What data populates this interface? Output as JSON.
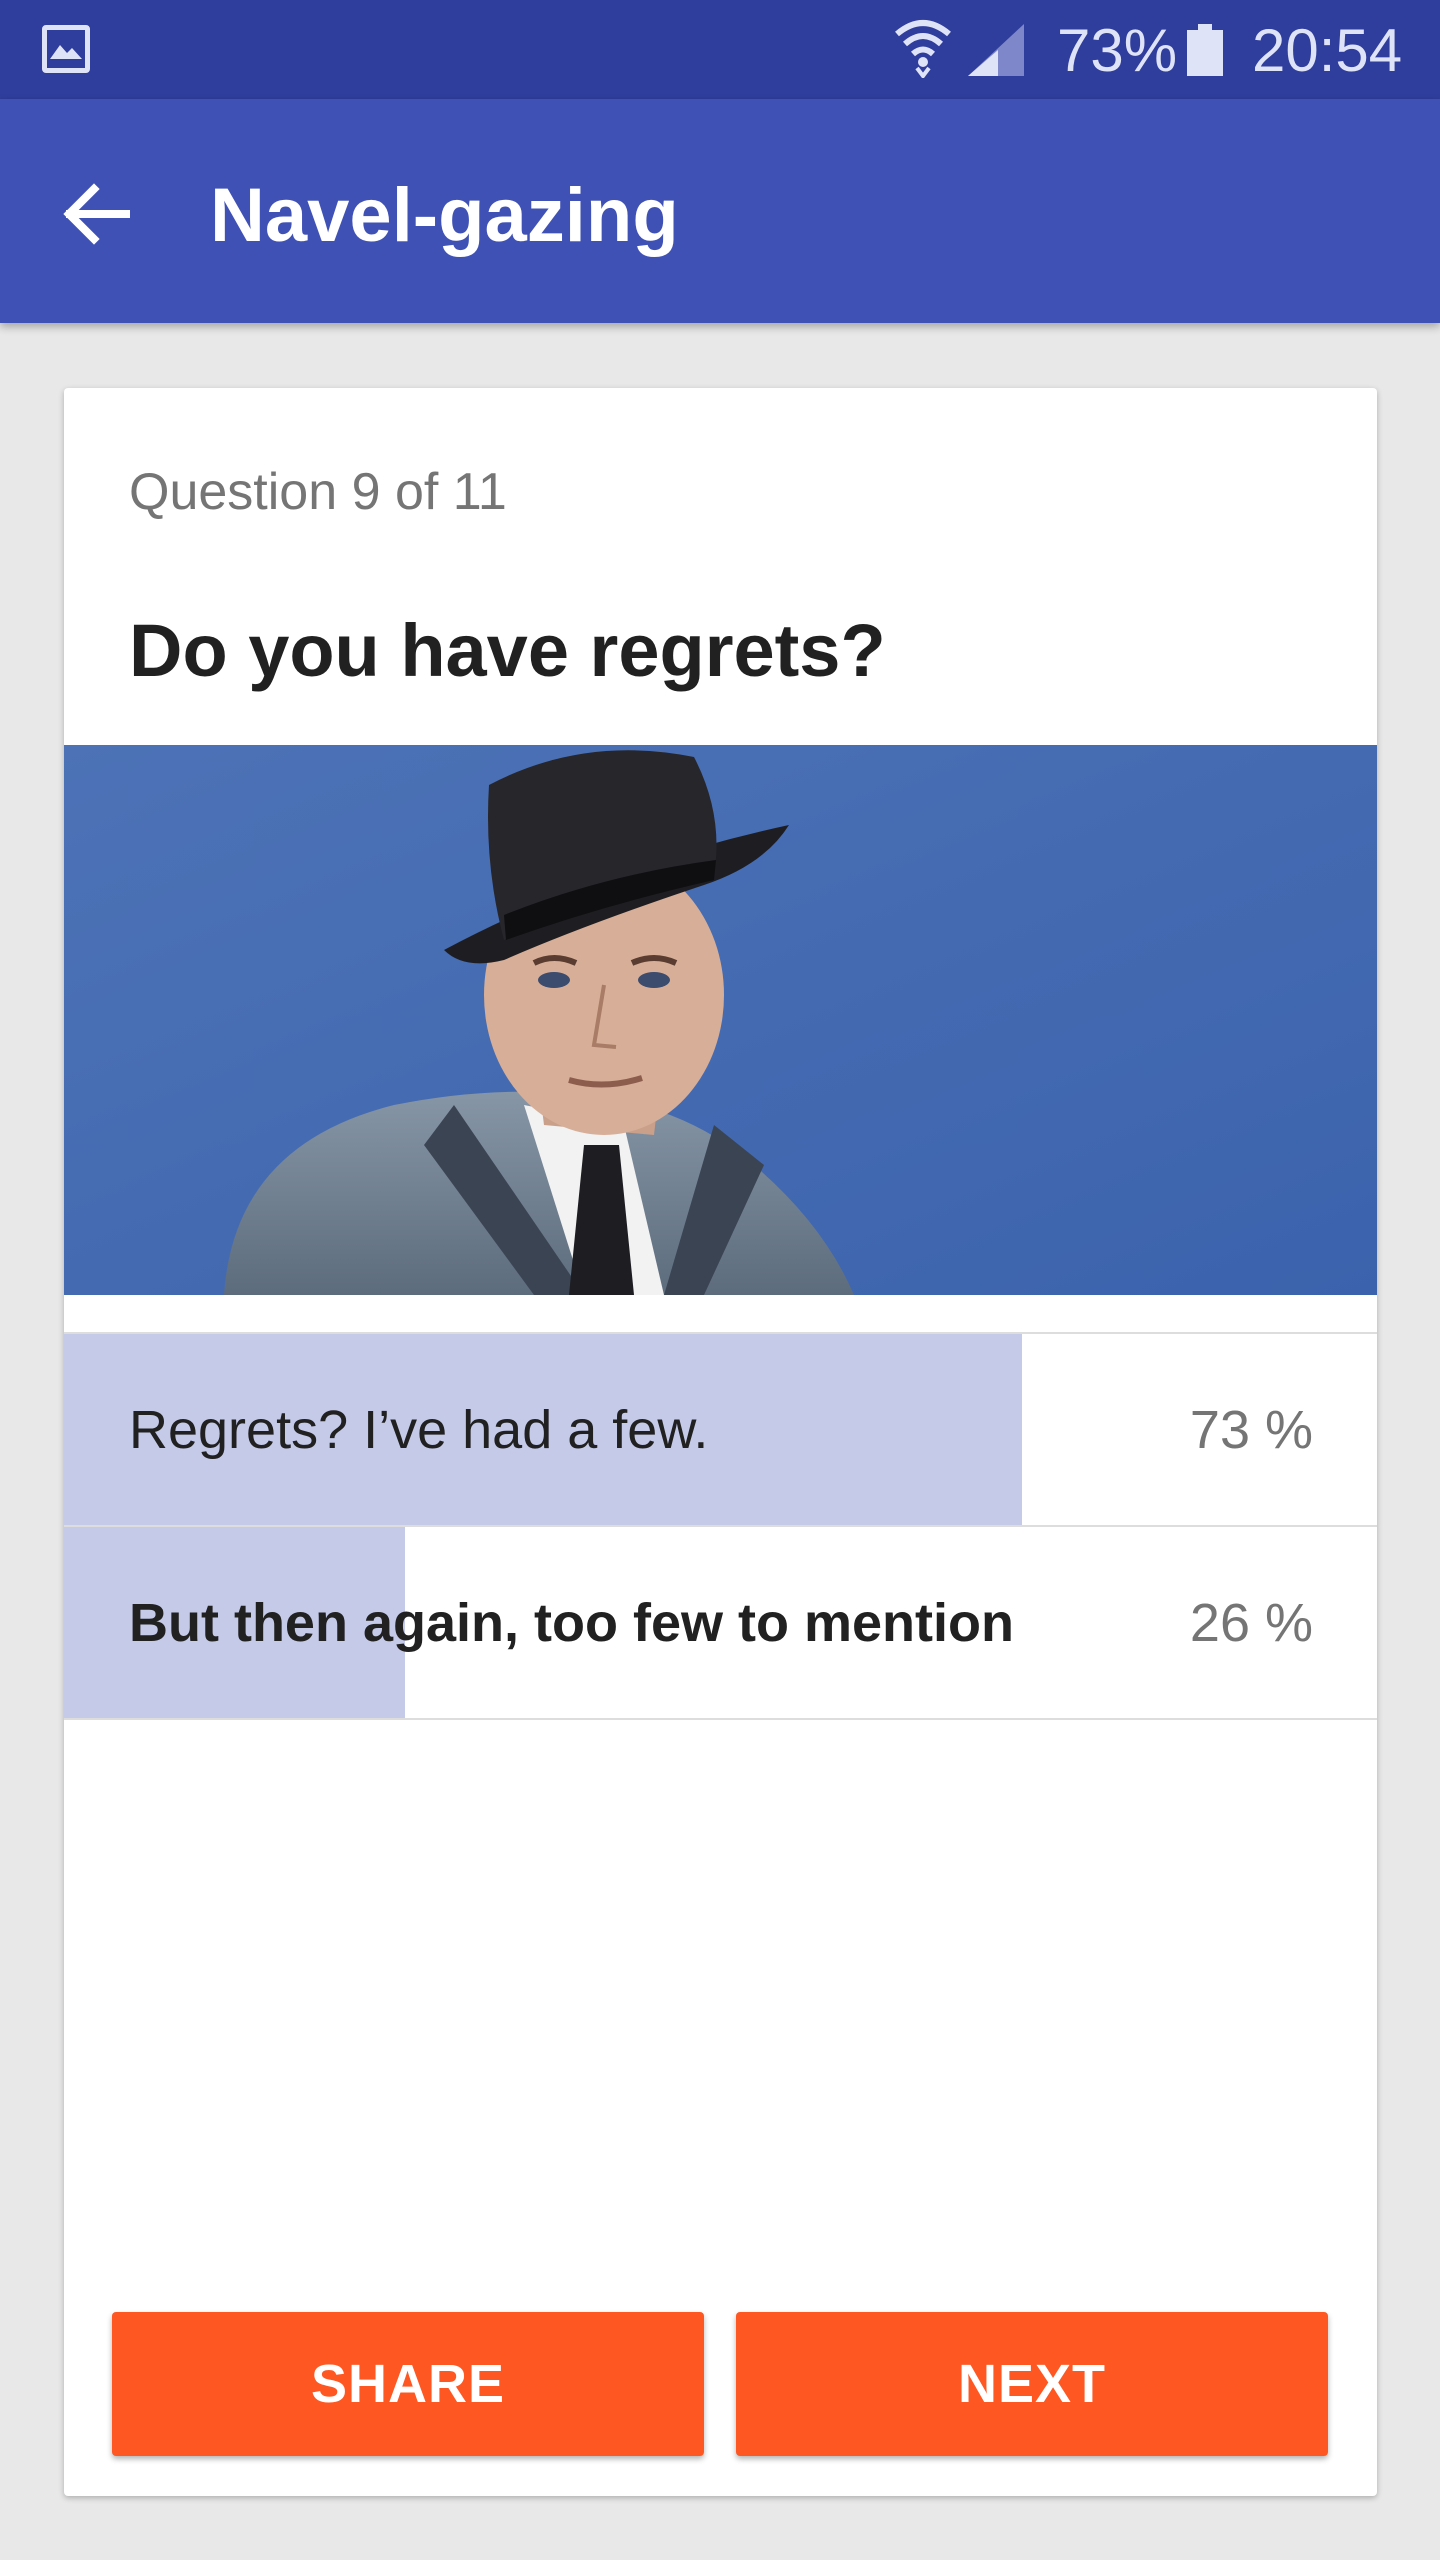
{
  "status_bar": {
    "battery_percent": "73%",
    "time": "20:54",
    "icons": [
      "gallery-icon",
      "wifi-icon",
      "cell-signal-icon",
      "battery-icon"
    ]
  },
  "app_bar": {
    "title": "Navel-gazing",
    "back_icon": "arrow-back-icon"
  },
  "question": {
    "counter": "Question 9 of 11",
    "title": "Do you have regrets?",
    "image": "portrait-photo"
  },
  "answers": [
    {
      "text": "Regrets? I’ve had a few.",
      "percent_label": "73 %",
      "share": 0.73,
      "chosen": false
    },
    {
      "text": "But then again, too few to mention",
      "percent_label": "26 %",
      "share": 0.26,
      "chosen": true
    }
  ],
  "actions": {
    "share_label": "SHARE",
    "next_label": "NEXT"
  },
  "colors": {
    "status_bar": "#2f3d9c",
    "app_bar": "#3f51b5",
    "result_bar": "#c5cae9",
    "button": "#ff5722",
    "background": "#e8e8e8"
  }
}
